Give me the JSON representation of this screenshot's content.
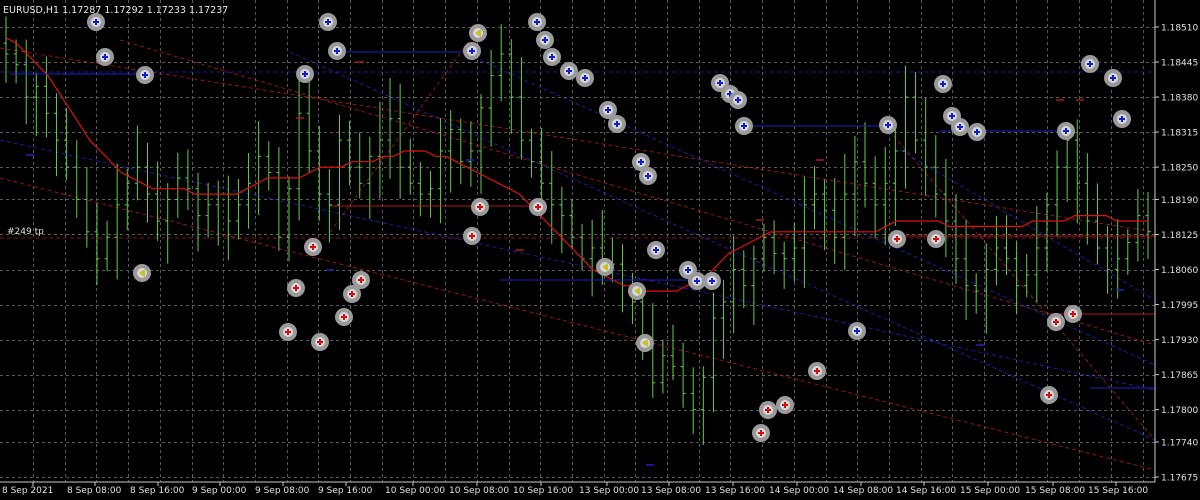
{
  "header": {
    "symbol_line": "EURUSD,H1  1.17287 1.17292 1.17233 1.17237"
  },
  "price_axis": {
    "labels": [
      "1.18510",
      "1.18445",
      "1.18380",
      "1.18315",
      "1.18250",
      "1.18190",
      "1.18125",
      "1.18060",
      "1.17995",
      "1.17930",
      "1.17865",
      "1.17800",
      "1.17740",
      "1.17675"
    ]
  },
  "time_axis": {
    "labels": [
      "8 Sep 2021",
      "8 Sep 08:00",
      "8 Sep 16:00",
      "9 Sep 00:00",
      "9 Sep 08:00",
      "9 Sep 16:00",
      "10 Sep 00:00",
      "10 Sep 08:00",
      "10 Sep 16:00",
      "13 Sep 00:00",
      "13 Sep 08:00",
      "13 Sep 16:00",
      "14 Sep 00:00",
      "14 Sep 08:00",
      "14 Sep 16:00",
      "15 Sep 00:00",
      "15 Sep 08:00",
      "15 Sep 16:00"
    ]
  },
  "annotation": {
    "tp_label": "#249 tp"
  },
  "colors": {
    "background": "#000000",
    "grid": "#5a5a5a",
    "candles": "#5fcf4a",
    "moving_average": "#e01010",
    "trend_red": "#b01818",
    "trend_blue": "#2020c0",
    "axis_text": "#e0e0e0",
    "marker_ring": "#9a9a9a"
  },
  "chart_data": {
    "type": "candlestick",
    "symbol": "EURUSD",
    "timeframe": "H1",
    "last_bar": {
      "open": 1.17287,
      "high": 1.17292,
      "low": 1.17233,
      "close": 1.17237
    },
    "ylim": [
      1.1764,
      1.1858
    ],
    "grid": true,
    "price_ticks": [
      1.1851,
      1.18445,
      1.1838,
      1.18315,
      1.1825,
      1.1819,
      1.18125,
      1.1806,
      1.17995,
      1.1793,
      1.17865,
      1.178,
      1.1774,
      1.17675
    ],
    "closes": [
      1.1846,
      1.1844,
      1.1838,
      1.184,
      1.1835,
      1.183,
      1.1825,
      1.1819,
      1.1813,
      1.1808,
      1.1812,
      1.1818,
      1.1822,
      1.1825,
      1.182,
      1.1815,
      1.1819,
      1.1823,
      1.1821,
      1.1816,
      1.1818,
      1.182,
      1.1815,
      1.1818,
      1.1822,
      1.1827,
      1.1824,
      1.1812,
      1.1821,
      1.1835,
      1.1828,
      1.182,
      1.1818,
      1.183,
      1.1825,
      1.1822,
      1.1827,
      1.183,
      1.1834,
      1.1825,
      1.1822,
      1.182,
      1.1821,
      1.1828,
      1.1832,
      1.1826,
      1.1828,
      1.1836,
      1.1842,
      1.1846,
      1.1838,
      1.183,
      1.1826,
      1.1822,
      1.1818,
      1.1816,
      1.1812,
      1.1808,
      1.181,
      1.1806,
      1.1807,
      1.1803,
      1.18,
      1.1793,
      1.1785,
      1.179,
      1.1788,
      1.1783,
      1.178,
      1.1786,
      1.1797,
      1.18,
      1.1806,
      1.1803,
      1.1808,
      1.1812,
      1.1809,
      1.1808,
      1.181,
      1.1818,
      1.182,
      1.1817,
      1.1812,
      1.182,
      1.1826,
      1.1822,
      1.1818,
      1.1822,
      1.1828,
      1.1838,
      1.183,
      1.1825,
      1.182,
      1.1815,
      1.1808,
      1.1803,
      1.1802,
      1.1806,
      1.181,
      1.1808,
      1.1803,
      1.1805,
      1.181,
      1.1818,
      1.1825,
      1.183,
      1.1822,
      1.1815,
      1.181,
      1.1806,
      1.1808,
      1.1811,
      1.1816,
      1.1813
    ],
    "moving_average": [
      1.1849,
      1.1848,
      1.1846,
      1.1844,
      1.1842,
      1.1839,
      1.1836,
      1.1833,
      1.183,
      1.1828,
      1.1826,
      1.1824,
      1.1823,
      1.1822,
      1.1821,
      1.1821,
      1.1821,
      1.1821,
      1.182,
      1.182,
      1.182,
      1.182,
      1.182,
      1.1821,
      1.1822,
      1.1823,
      1.1823,
      1.1823,
      1.1823,
      1.1824,
      1.1825,
      1.1825,
      1.1825,
      1.1826,
      1.1826,
      1.1826,
      1.1827,
      1.1827,
      1.1828,
      1.1828,
      1.1828,
      1.1827,
      1.1827,
      1.1826,
      1.1825,
      1.1824,
      1.1823,
      1.1822,
      1.1821,
      1.182,
      1.1818,
      1.1816,
      1.1814,
      1.1812,
      1.181,
      1.1808,
      1.1806,
      1.1805,
      1.1804,
      1.1803,
      1.1803,
      1.1802,
      1.1802,
      1.1802,
      1.1802,
      1.1803,
      1.1804,
      1.1805,
      1.1807,
      1.1809,
      1.181,
      1.1811,
      1.1812,
      1.1813,
      1.1813,
      1.1813,
      1.1813,
      1.1813,
      1.1813,
      1.1813,
      1.1813,
      1.1813,
      1.1813,
      1.1813,
      1.1814,
      1.1815,
      1.1815,
      1.1815,
      1.1815,
      1.1815,
      1.1814,
      1.1814,
      1.1814,
      1.1814,
      1.1814,
      1.1814,
      1.1814,
      1.1814,
      1.1815,
      1.1815,
      1.1815,
      1.1815,
      1.1816,
      1.1816,
      1.1816,
      1.1816,
      1.1815,
      1.1815,
      1.1815,
      1.1815
    ]
  }
}
